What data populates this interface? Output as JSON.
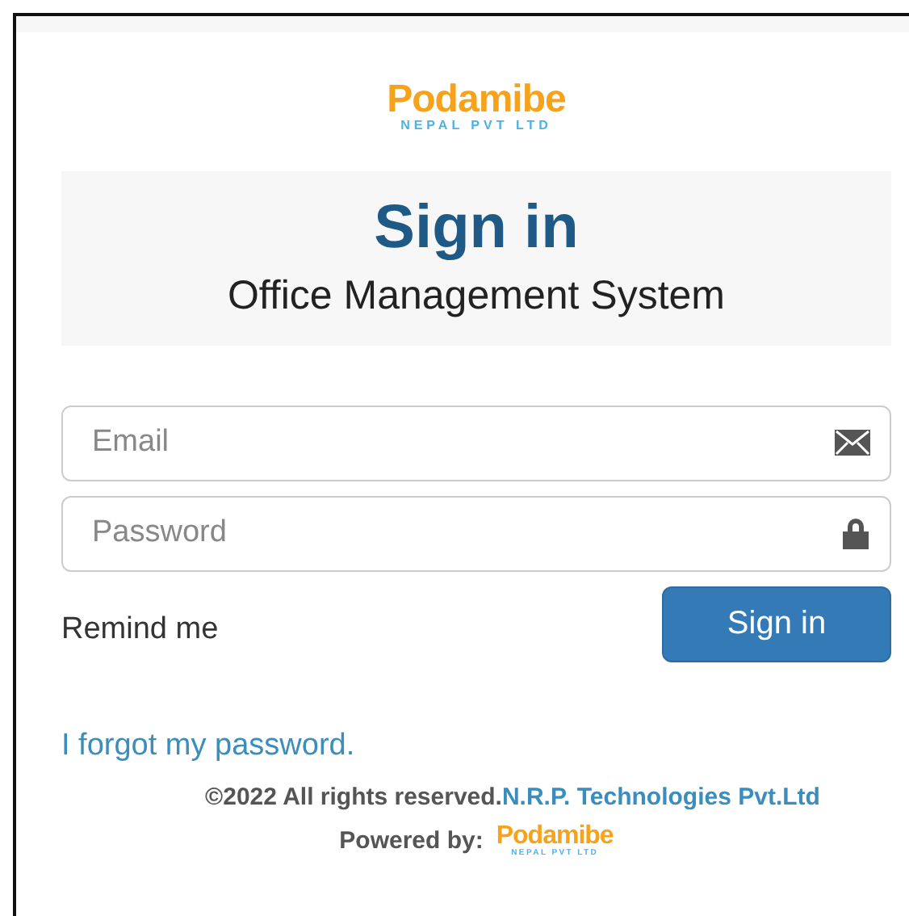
{
  "logo": {
    "name": "Podamibe",
    "tagline": "NEPAL PVT LTD"
  },
  "header": {
    "title": "Sign in",
    "subtitle": "Office Management System"
  },
  "fields": [
    {
      "placeholder": "Email",
      "kind": "email"
    },
    {
      "placeholder": "Password",
      "kind": "password"
    }
  ],
  "remember_label": "Remind me",
  "submit_button": "Sign in",
  "forgot_link": "I forgot my password.",
  "footer": {
    "copyright": "©2022 All rights reserved.",
    "company_link": "N.R.P. Technologies Pvt.Ltd",
    "powered_by": "Powered by:",
    "logo": {
      "name": "Podamibe",
      "tagline": "NEPAL PVT LTD"
    }
  }
}
